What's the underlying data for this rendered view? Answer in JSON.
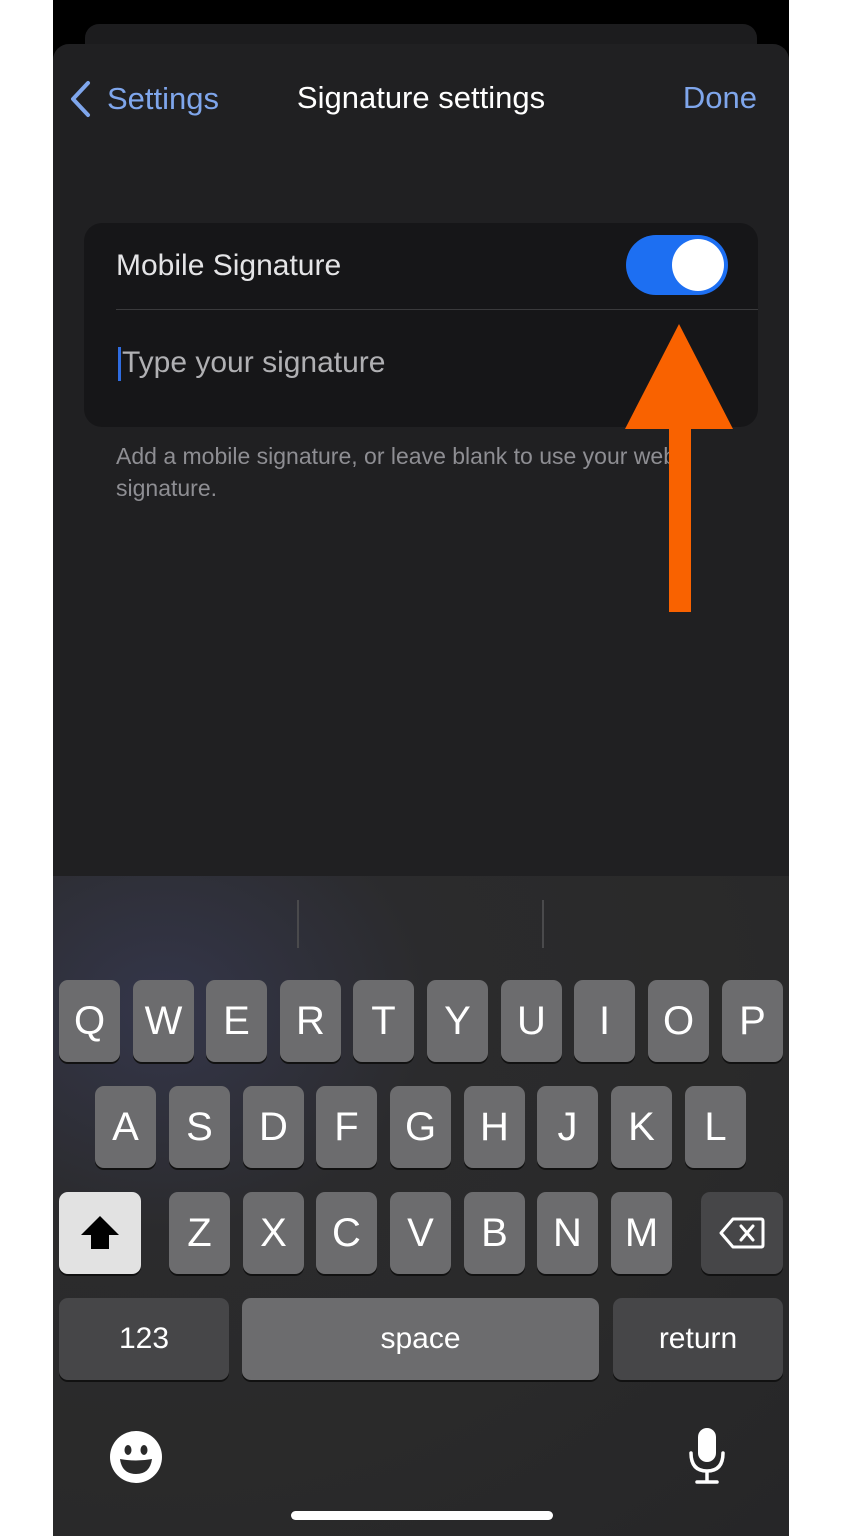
{
  "nav": {
    "back_label": "Settings",
    "title": "Signature settings",
    "done_label": "Done"
  },
  "signature": {
    "toggle_label": "Mobile Signature",
    "toggle_state": "on",
    "placeholder": "Type your signature",
    "helper": "Add a mobile signature, or leave blank to use your web signature."
  },
  "keyboard": {
    "row1": [
      "Q",
      "W",
      "E",
      "R",
      "T",
      "Y",
      "U",
      "I",
      "O",
      "P"
    ],
    "row2": [
      "A",
      "S",
      "D",
      "F",
      "G",
      "H",
      "J",
      "K",
      "L"
    ],
    "row3": [
      "Z",
      "X",
      "C",
      "V",
      "B",
      "N",
      "M"
    ],
    "numbers_label": "123",
    "space_label": "space",
    "return_label": "return",
    "shift_icon": "shift-icon",
    "delete_icon": "delete-icon",
    "emoji_icon": "emoji-icon",
    "mic_icon": "microphone-icon"
  },
  "annotation": {
    "arrow_color": "#f96200",
    "points_to": "toggle"
  },
  "colors": {
    "accent": "#7fa6ec",
    "toggle_on": "#1d6ff2"
  }
}
